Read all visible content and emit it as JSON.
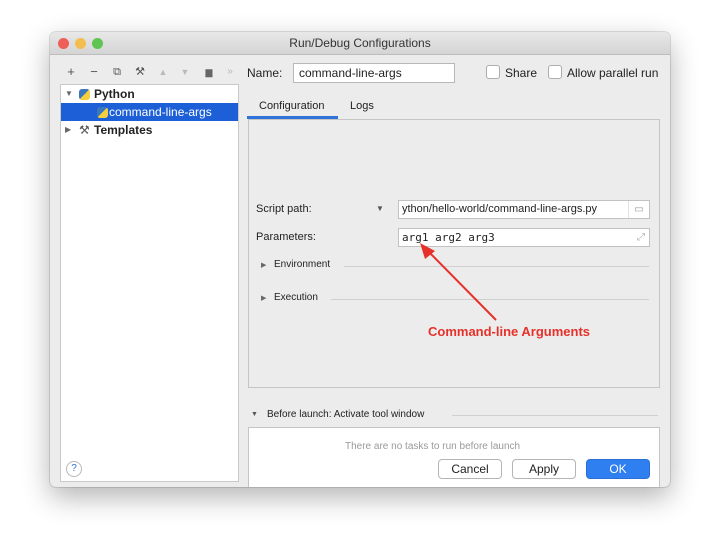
{
  "window": {
    "title": "Run/Debug Configurations",
    "traffic_lights": [
      "#ed5f57",
      "#f4be4f",
      "#5fc452"
    ]
  },
  "toolbar": {
    "add": "+",
    "remove": "−",
    "copy": "⧉",
    "edit": "⚒",
    "move_up": "▲",
    "move_down": "▼",
    "folder": "▆",
    "more": "»"
  },
  "tree": {
    "python": {
      "expander": "▼",
      "label": "Python"
    },
    "config": {
      "label": "command-line-args"
    },
    "templates": {
      "expander": "▶",
      "label": "Templates"
    }
  },
  "header": {
    "name_label": "Name:",
    "name_value": "command-line-args",
    "share_label": "Share",
    "parallel_label": "Allow parallel run"
  },
  "tabs": {
    "configuration": "Configuration",
    "logs": "Logs"
  },
  "form": {
    "script_label": "Script path:",
    "script_dropdown": "▼",
    "script_value": "ython/hello-world/command-line-args.py",
    "parameters_label": "Parameters:",
    "parameters_value": "arg1 arg2 arg3",
    "expand_icon": "⤢",
    "environment_label": "Environment",
    "execution_label": "Execution",
    "section_arrow": "▶"
  },
  "annotation": {
    "text": "Command-line Arguments",
    "color": "#e6312b"
  },
  "before_launch": {
    "expander": "▼",
    "label": "Before launch: Activate tool window",
    "placeholder": "There are no tasks to run before launch"
  },
  "buttons": {
    "help": "?",
    "cancel": "Cancel",
    "apply": "Apply",
    "ok": "OK"
  }
}
